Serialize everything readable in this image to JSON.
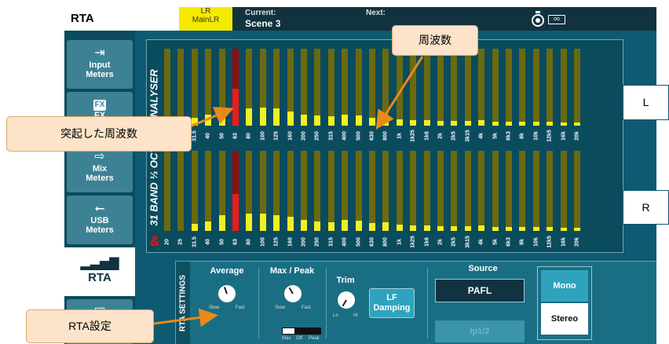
{
  "header": {
    "screen_title": "RTA",
    "bus_line1": "LR",
    "bus_line2": "MainLR",
    "current_label": "Current:",
    "current_value": "Scene 3",
    "next_label": "Next:",
    "battery_text": "oo"
  },
  "sidebar": {
    "items": [
      {
        "label_line1": "Input",
        "label_line2": "Meters",
        "icon": "input-meters-icon"
      },
      {
        "label_line1": "FX",
        "label_line2": "",
        "icon": "fx-icon"
      },
      {
        "label_line1": "Mix",
        "label_line2": "Meters",
        "icon": "mix-meters-icon"
      },
      {
        "label_line1": "USB",
        "label_line2": "Meters",
        "icon": "usb-icon"
      },
      {
        "label_line1": "RTA",
        "label_line2": "",
        "icon": "rta-icon",
        "active": true
      },
      {
        "label_line1": "",
        "label_line2": "",
        "icon": "gigs-icon"
      }
    ]
  },
  "rta": {
    "vertical_title": "31 BAND ⅓ OCTAVE ANALYSER",
    "bands": [
      "20",
      "25",
      "31.5",
      "40",
      "50",
      "63",
      "80",
      "100",
      "125",
      "160",
      "200",
      "250",
      "315",
      "400",
      "500",
      "630",
      "800",
      "1k",
      "1k25",
      "1k6",
      "2k",
      "2k5",
      "3k15",
      "4k",
      "5k",
      "6k3",
      "8k",
      "10k",
      "12k5",
      "16k",
      "20k"
    ],
    "left_levels": [
      0,
      0,
      0.1,
      0.14,
      0.2,
      0.48,
      0.22,
      0.23,
      0.22,
      0.18,
      0.14,
      0.13,
      0.12,
      0.14,
      0.13,
      0.1,
      0.11,
      0.08,
      0.07,
      0.07,
      0.06,
      0.06,
      0.06,
      0.07,
      0.05,
      0.05,
      0.05,
      0.05,
      0.05,
      0.04,
      0.04
    ],
    "right_levels": [
      0,
      0,
      0.09,
      0.12,
      0.2,
      0.46,
      0.22,
      0.22,
      0.2,
      0.18,
      0.14,
      0.12,
      0.11,
      0.14,
      0.13,
      0.1,
      0.11,
      0.08,
      0.07,
      0.07,
      0.06,
      0.06,
      0.06,
      0.07,
      0.05,
      0.05,
      0.05,
      0.05,
      0.05,
      0.04,
      0.04
    ],
    "peak_band": "63"
  },
  "settings": {
    "vertical_title": "RTA SETTINGS",
    "average_title": "Average",
    "average_slow": "Slow",
    "average_fast": "Fast",
    "maxpeak_title": "Max / Peak",
    "maxpeak_slow": "Slow",
    "maxpeak_fast": "Fast",
    "toggle_max": "Max",
    "toggle_off": "Off",
    "toggle_peak": "Peak",
    "trim_title": "Trim",
    "trim_lo": "Lo",
    "trim_hi": "Hi",
    "lf_line1": "LF",
    "lf_line2": "Damping",
    "source_title": "Source",
    "source_value": "PAFL",
    "source_sub": "Ip1/2",
    "mono_label": "Mono",
    "stereo_label": "Stereo"
  },
  "annotations": {
    "frequency": "周波数",
    "peak_frequency": "突起した周波数",
    "rta_settings": "RTA設定",
    "left_channel": "L",
    "right_channel": "R"
  },
  "colors": {
    "meter_background": "#6b6a10",
    "meter_level": "#f2f020",
    "peak_background": "#8a0f0f",
    "peak_level": "#ee1a1a",
    "annotation_fill": "#fce3c9",
    "arrow": "#e88a1a"
  }
}
